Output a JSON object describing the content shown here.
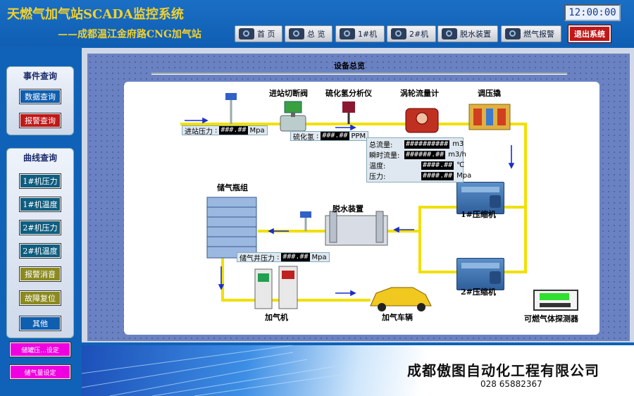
{
  "header": {
    "title": "天燃气加气站SCADA监控系统",
    "subtitle": "——成都温江金府路CNG加气站",
    "clock": "12:00:00"
  },
  "nav": [
    {
      "label": "首 页",
      "icon": "home-icon"
    },
    {
      "label": "总 览",
      "icon": "overview-icon"
    },
    {
      "label": "1#机",
      "icon": "machine-icon"
    },
    {
      "label": "2#机",
      "icon": "machine-icon"
    },
    {
      "label": "脱水装置",
      "icon": "dehydrator-icon"
    },
    {
      "label": "燃气报警",
      "icon": "alarm-icon"
    }
  ],
  "exit_label": "退出系统",
  "sidebar": {
    "event_title": "事件查询",
    "event_buttons": [
      "数据查询",
      "报警查询"
    ],
    "curve_title": "曲线查询",
    "curve_buttons": [
      "1#机压力",
      "1#机温度",
      "2#机压力",
      "2#机温度",
      "报警消音",
      "故障复位",
      "其他"
    ],
    "pink_buttons": [
      "储罐压...设定",
      "储气量设定"
    ]
  },
  "overview": {
    "title": "设备总览",
    "labels": {
      "valve": "进站切断阀",
      "h2s": "硫化氢分析仪",
      "flowmeter": "涡轮流量计",
      "regulator": "调压撬",
      "storage": "储气瓶组",
      "dehydrator": "脱水装置",
      "comp1": "1#压缩机",
      "comp2": "2#压缩机",
      "dispenser": "加气机",
      "vehicle": "加气车辆",
      "gas_detector": "可燃气体探测器"
    },
    "inlet": {
      "label": "进站压力",
      "value": "###.##",
      "unit": "Mpa"
    },
    "h2s_reading": {
      "label": "硫化氢",
      "value": "###.##",
      "unit": "PPM"
    },
    "storage_reading": {
      "label": "储气井压力",
      "value": "###.##",
      "unit": "Mpa"
    },
    "flow": [
      {
        "label": "总流量:",
        "value": "##########",
        "unit": "m3"
      },
      {
        "label": "瞬时流量:",
        "value": "######.##",
        "unit": "m3/h"
      },
      {
        "label": "温度:",
        "value": "####.##",
        "unit": "℃"
      },
      {
        "label": "压力:",
        "value": "####.##",
        "unit": "Mpa"
      }
    ]
  },
  "footer": {
    "company": "成都傲图自动化工程有限公司",
    "phone": "028  65882367"
  },
  "colors": {
    "accent": "#f0d030",
    "background": "#0f62b7",
    "pipe": "#f0e000",
    "alarm": "#c01818"
  }
}
